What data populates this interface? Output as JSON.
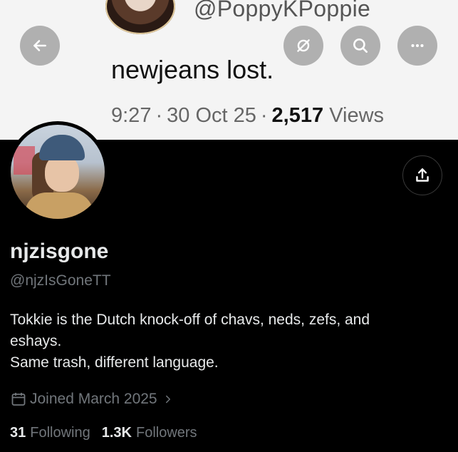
{
  "banner": {
    "handle": "@PoppyKPoppie",
    "tweet_text": "newjeans lost.",
    "time": "9:27",
    "date": "30 Oct 25",
    "views_count": "2,517",
    "views_label": "Views"
  },
  "top_bar": {
    "back_icon": "arrow-left-icon",
    "grok_icon": "grok-icon",
    "search_icon": "search-icon",
    "more_icon": "more-icon"
  },
  "profile": {
    "display_name": "njzisgone",
    "handle": "@njzIsGoneTT",
    "bio_lines": [
      "Tokkie is the Dutch knock-off of chavs, neds, zefs, and",
      "eshays.",
      "Same trash, different language."
    ],
    "joined": "Joined March 2025",
    "following_count": "31",
    "following_label": "Following",
    "followers_count": "1.3K",
    "followers_label": "Followers"
  },
  "colors": {
    "background": "#000000",
    "text_primary": "#e7e9ea",
    "text_secondary": "#71767b"
  }
}
